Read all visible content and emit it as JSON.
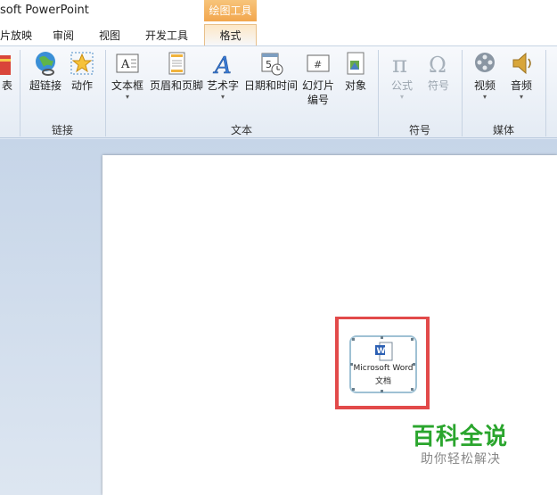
{
  "titlebar": {
    "app_title": "soft PowerPoint",
    "context_group": "绘图工具"
  },
  "tabs": [
    {
      "label": "片放映"
    },
    {
      "label": "审阅"
    },
    {
      "label": "视图"
    },
    {
      "label": "开发工具"
    },
    {
      "label": "格式",
      "active": true
    }
  ],
  "ribbon": {
    "groups": {
      "links": "链接",
      "text": "文本",
      "symbols": "符号",
      "media": "媒体"
    },
    "buttons": {
      "table_partial": "表",
      "hyperlink": "超链接",
      "action": "动作",
      "textbox": "文本框",
      "header_footer": "页眉和页脚",
      "wordart": "艺术字",
      "datetime": "日期和时间",
      "slide_number_1": "幻灯片",
      "slide_number_2": "编号",
      "object": "对象",
      "equation": "公式",
      "symbol": "符号",
      "video": "视频",
      "audio": "音频"
    }
  },
  "slide": {
    "object_label_1": "Microsoft Word",
    "object_label_2": "文档"
  },
  "watermark": {
    "title": "百科全说",
    "subtitle": "助你轻松解决"
  },
  "colors": {
    "accent": "#f2a64d",
    "highlight": "#e24a4a",
    "watermark": "#2aa52d"
  }
}
